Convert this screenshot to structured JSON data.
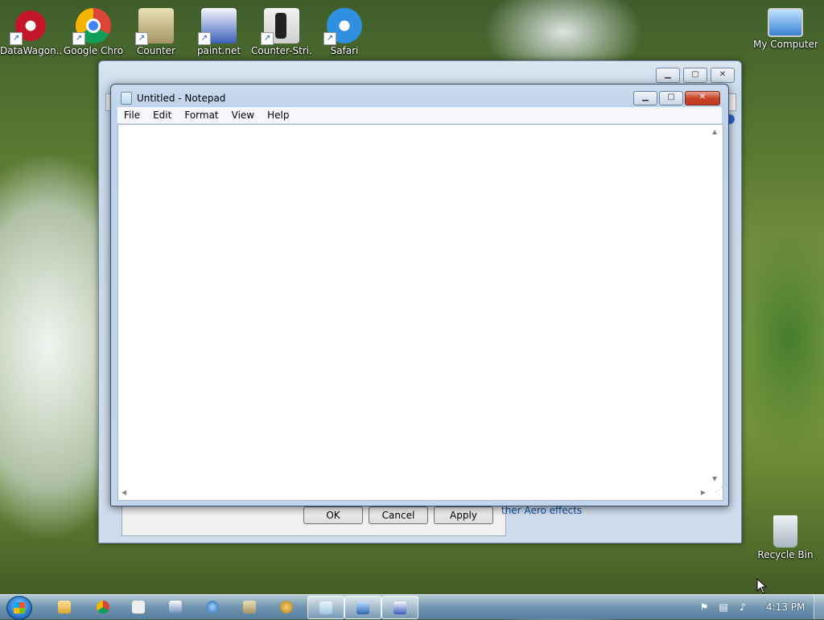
{
  "desktop": {
    "icons": [
      {
        "label": "DataWagon...",
        "icon": "datawagon-icon"
      },
      {
        "label": "Google Chro",
        "icon": "chrome-icon"
      },
      {
        "label": "Counter",
        "icon": "counter-icon"
      },
      {
        "label": "paint.net",
        "icon": "paintnet-icon"
      },
      {
        "label": "Counter-Stri...",
        "icon": "counter-strike-icon"
      },
      {
        "label": "Safari",
        "icon": "safari-icon"
      },
      {
        "label": "My Computer",
        "icon": "computer-icon"
      },
      {
        "label": "Recycle Bin",
        "icon": "recycle-bin-icon"
      }
    ]
  },
  "background_dialog": {
    "buttons": {
      "ok": "OK",
      "cancel": "Cancel",
      "apply": "Apply"
    },
    "link": "ther Aero effects"
  },
  "notepad": {
    "title": "Untitled - Notepad",
    "menu": [
      "File",
      "Edit",
      "Format",
      "View",
      "Help"
    ],
    "content": ""
  },
  "taskbar": {
    "clock": "4:13 PM",
    "pinned": [
      "explorer-icon",
      "chrome-icon",
      "counter-strike-icon",
      "paint-icon",
      "globe-icon",
      "paint-palette-icon",
      "notepad-icon",
      "performance-icon",
      "paintnet-icon"
    ]
  },
  "colors": {
    "accent": "#1b57c8",
    "close": "#c8442b"
  }
}
